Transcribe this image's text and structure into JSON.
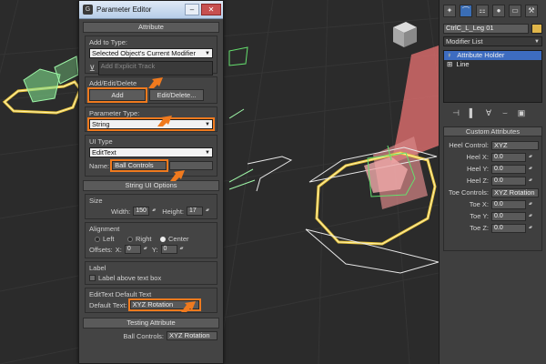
{
  "dialog": {
    "title": "Parameter Editor",
    "title_icon": "max-logo-icon",
    "attribute_header": "Attribute",
    "add_to_type": {
      "label": "Add to Type:",
      "value": "Selected Object's Current Modifier",
      "track_placeholder": "Add Explicit Track"
    },
    "add_edit_delete": {
      "label": "Add/Edit/Delete",
      "add": "Add",
      "edit_delete": "Edit/Delete..."
    },
    "parameter_type": {
      "label": "Parameter Type:",
      "value": "String"
    },
    "ui_type": {
      "label": "UI Type",
      "value": "EditText",
      "name_label": "Name:",
      "name_value": "Ball Controls"
    },
    "string_ui_header": "String UI Options",
    "size": {
      "label": "Size",
      "width_label": "Width:",
      "width": "150",
      "height_label": "Height:",
      "height": "17"
    },
    "alignment": {
      "label": "Alignment",
      "left": "Left",
      "right": "Right",
      "center": "Center",
      "selected": "Center",
      "offsets_label": "Offsets:",
      "x_label": "X:",
      "x": "0",
      "y_label": "Y:",
      "y": "0"
    },
    "label_group": {
      "label": "Label",
      "checkbox": "Label above text box"
    },
    "default_text": {
      "label": "EditText Default Text",
      "field_label": "Default Text:",
      "value": "XYZ Rotation"
    },
    "testing_header": "Testing Attribute",
    "testing": {
      "label": "Ball Controls:",
      "value": "XYZ Rotation"
    }
  },
  "panel": {
    "tabs": [
      "create-icon",
      "modify-icon",
      "hierarchy-icon",
      "motion-icon",
      "display-icon",
      "utilities-icon"
    ],
    "object_name": "CtrlC_L_Leg 01",
    "object_color": "#e0b64a",
    "modifier_list": "Modifier List",
    "stack": [
      "Attribute Holder",
      "Line"
    ],
    "custom_attributes": {
      "header": "Custom Attributes",
      "heel_control_label": "Heel Control:",
      "heel_control": "XYZ",
      "heel_x_label": "Heel X:",
      "heel_x": "0.0",
      "heel_y_label": "Heel Y:",
      "heel_y": "0.0",
      "heel_z_label": "Heel Z:",
      "heel_z": "0.0",
      "toe_controls_label": "Toe Controls:",
      "toe_controls": "XYZ Rotation",
      "toe_x_label": "Toe X:",
      "toe_x": "0.0",
      "toe_y_label": "Toe Y:",
      "toe_y": "0.0",
      "toe_z_label": "Toe Z:",
      "toe_z": "0.0"
    }
  },
  "colors": {
    "highlight": "#f07a1e",
    "selection": "#3d6cc0",
    "viewport_bg": "#2b2b2b"
  }
}
